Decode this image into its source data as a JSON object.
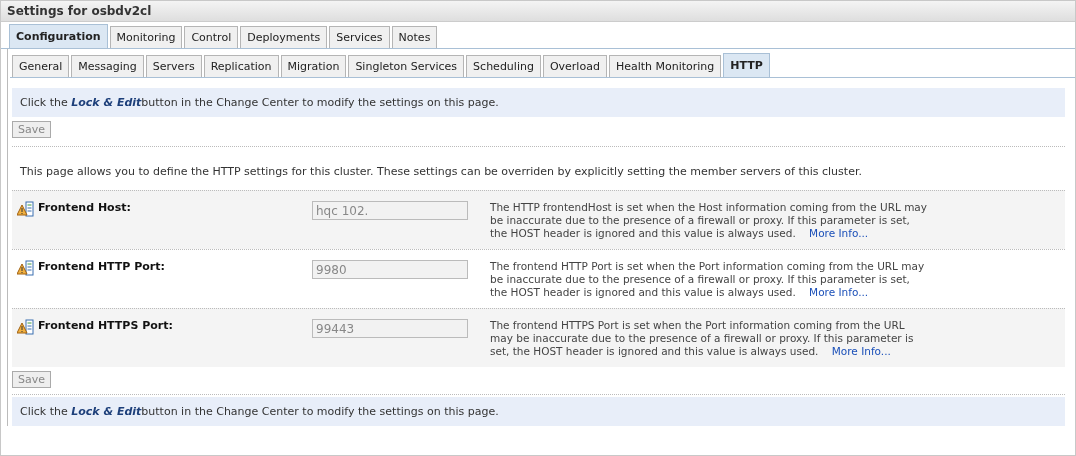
{
  "window": {
    "title": "Settings for osbdv2cl"
  },
  "tabs": [
    {
      "label": "Configuration",
      "selected": true
    },
    {
      "label": "Monitoring",
      "selected": false
    },
    {
      "label": "Control",
      "selected": false
    },
    {
      "label": "Deployments",
      "selected": false
    },
    {
      "label": "Services",
      "selected": false
    },
    {
      "label": "Notes",
      "selected": false
    }
  ],
  "subtabs": [
    {
      "label": "General",
      "selected": false
    },
    {
      "label": "Messaging",
      "selected": false
    },
    {
      "label": "Servers",
      "selected": false
    },
    {
      "label": "Replication",
      "selected": false
    },
    {
      "label": "Migration",
      "selected": false
    },
    {
      "label": "Singleton Services",
      "selected": false
    },
    {
      "label": "Scheduling",
      "selected": false
    },
    {
      "label": "Overload",
      "selected": false
    },
    {
      "label": "Health Monitoring",
      "selected": false
    },
    {
      "label": "HTTP",
      "selected": true
    }
  ],
  "notice_top": "Click the **Lock & Edit**button in the Change Center to modify the settings on this page.",
  "save_top": {
    "label": "Save",
    "disabled": true
  },
  "intro": "This page allows you to define the HTTP settings for this cluster. These settings can be overriden by explicitly setting the member servers of this cluster.",
  "fields": [
    {
      "label": "Frontend Host:",
      "value": "hqc 102.",
      "disabled": true,
      "help": "The HTTP frontendHost is set when the Host information coming from the URL may be inaccurate due to the presence of a firewall or proxy. If this parameter is set, the HOST header is ignored and this value is always used.",
      "link": "More Info..."
    },
    {
      "label": "Frontend HTTP Port:",
      "value": "9980",
      "disabled": true,
      "help": "The frontend HTTP Port is set when the Port information coming from the URL may be inaccurate due to the presence of a firewall or proxy. If this parameter is set, the HOST header is ignored and this value is always used.",
      "link": "More Info..."
    },
    {
      "label": "Frontend HTTPS Port:",
      "value": "99443",
      "disabled": true,
      "help": "The frontend HTTPS Port is set when the Port information coming from the URL may be inaccurate due to the presence of a firewall or proxy. If this parameter is set, the HOST header is ignored and this value is always used.",
      "link": "More Info..."
    }
  ],
  "save_bottom": {
    "label": "Save",
    "disabled": true
  },
  "notice_bottom": "Click the **Lock & Edit**button in the Change Center to modify the settings on this page."
}
